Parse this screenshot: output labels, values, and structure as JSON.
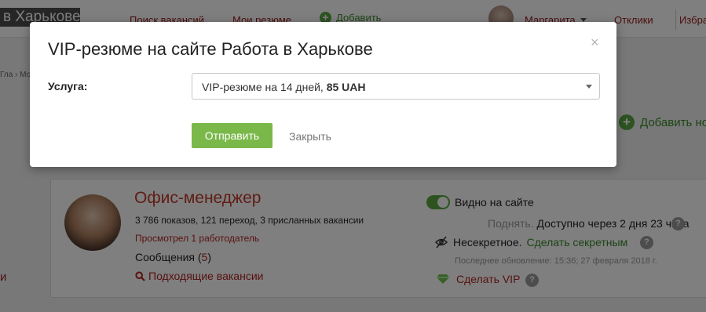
{
  "header": {
    "logo_text": "в Харькове",
    "nav": {
      "search": "Поиск вакансий",
      "my_resumes": "Мои резюме",
      "add": "Добавить",
      "user": "Маргарита",
      "responses": "Отклики",
      "favorites": "Избра"
    }
  },
  "breadcrumb": "Гла › Мо",
  "add_resume": "Добавить но",
  "left_fragment": "и",
  "resume": {
    "title": "Офис-менеджер",
    "stats": "3 786 показов, 121 переход, 3 присланных вакансии",
    "viewed": "Просмотрел 1 работодатель",
    "messages_label": "Сообщения",
    "messages_open": " (",
    "messages_count": "5",
    "messages_close": ")",
    "vacancies_link": "Подходящие вакансии",
    "visible_label": "Видно на сайте",
    "raise_label": "Поднять.",
    "raise_info": "Доступно через 2 дня 23 часа",
    "secret_label": "Несекретное.",
    "secret_link": "Сделать секретным",
    "updated": "Последнее обновление: 15:36; 27 февраля 2018 г.",
    "vip_link": "Сделать VIP",
    "help_glyph": "?"
  },
  "modal": {
    "title": "VIP-резюме на сайте Работа в Харькове",
    "close_glyph": "×",
    "service_label": "Услуга:",
    "service_value_text": "VIP-резюме на 14 дней,",
    "service_value_price": "85 UAH",
    "send_label": "Отправить",
    "cancel_label": "Закрыть"
  },
  "colors": {
    "accent_green": "#7ab84a",
    "brand_red": "#c0392b",
    "link_green": "#3a8a2a"
  },
  "icons": {
    "search": "magnifier-icon",
    "secret": "no-eye-icon",
    "vip": "diamond-icon"
  }
}
